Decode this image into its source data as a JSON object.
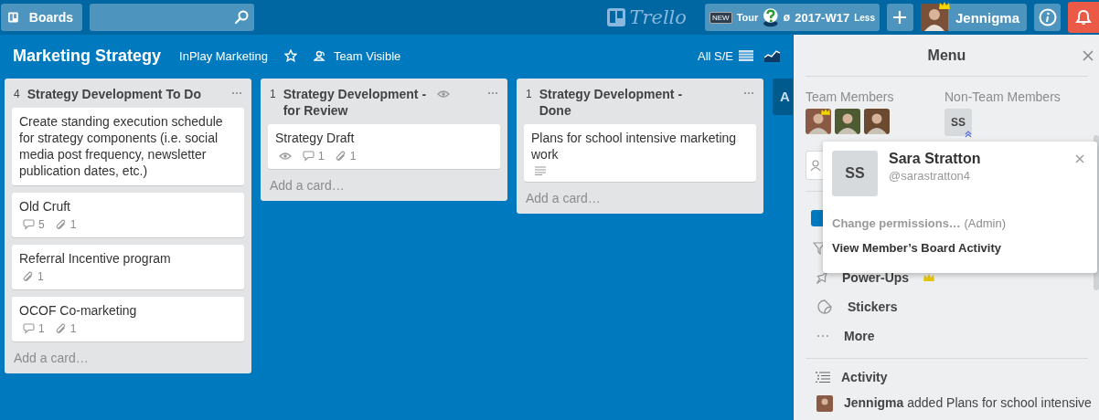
{
  "header": {
    "boards_button": "Boards",
    "logo": "Trello",
    "tour": {
      "badge": "NEW",
      "label": "Tour",
      "symbol": "ø",
      "week": "2017-W17",
      "toggle": "Less"
    },
    "user": {
      "name": "Jennigma",
      "admin": true
    }
  },
  "board": {
    "title": "Marketing Strategy",
    "team": "InPlay Marketing",
    "starred": false,
    "visibility": "Team Visible",
    "filter": "All S/E"
  },
  "lists": [
    {
      "count": "4",
      "title": "Strategy Development To Do",
      "watched": false,
      "add_card": "Add a card…",
      "cards": [
        {
          "title": "Create standing execution schedule for strategy components (i.e. social media post frequency, newsletter publication dates, etc.)"
        },
        {
          "title": "Old Cruft",
          "badges": [
            {
              "kind": "comment",
              "count": "5"
            },
            {
              "kind": "attachment",
              "count": "1"
            }
          ]
        },
        {
          "title": "Referral Incentive program",
          "badges": [
            {
              "kind": "attachment",
              "count": "1"
            }
          ]
        },
        {
          "title": "OCOF Co-marketing",
          "badges": [
            {
              "kind": "comment",
              "count": "1"
            },
            {
              "kind": "attachment",
              "count": "1"
            }
          ]
        }
      ]
    },
    {
      "count": "1",
      "title": "Strategy Development - for Review",
      "watched": true,
      "add_card": "Add a card…",
      "cards": [
        {
          "title": "Strategy Draft",
          "badges": [
            {
              "kind": "watch"
            },
            {
              "kind": "comment",
              "count": "1"
            },
            {
              "kind": "attachment",
              "count": "1"
            }
          ]
        }
      ]
    },
    {
      "count": "1",
      "title": "Strategy Development - Done",
      "watched": false,
      "add_card": "Add a card…",
      "cards": [
        {
          "title": "Plans for school intensive marketing work",
          "badges": [
            {
              "kind": "description"
            }
          ]
        }
      ]
    }
  ],
  "add_list": "A",
  "menu": {
    "title": "Menu",
    "team_label": "Team Members",
    "team_members": [
      {
        "admin": true
      },
      {
        "admin": false
      },
      {
        "admin": false
      }
    ],
    "non_team_label": "Non-Team Members",
    "non_team_members": [
      {
        "initials": "SS"
      }
    ],
    "items": [
      {
        "kind": "powerups",
        "label": "Power-Ups",
        "premium": true
      },
      {
        "kind": "stickers",
        "label": "Stickers",
        "premium": false
      },
      {
        "kind": "more",
        "label": "More",
        "premium": false
      }
    ],
    "activity": {
      "title": "Activity",
      "entries": [
        {
          "member": "Jennigma",
          "text": "added Plans for school intensive"
        }
      ]
    }
  },
  "popover": {
    "initials": "SS",
    "name": "Sara Stratton",
    "username": "@sarastratton4",
    "actions": [
      {
        "label": "Change permissions…",
        "note": "(Admin)",
        "disabled": true
      },
      {
        "label": "View Member’s Board Activity",
        "disabled": false
      }
    ]
  }
}
